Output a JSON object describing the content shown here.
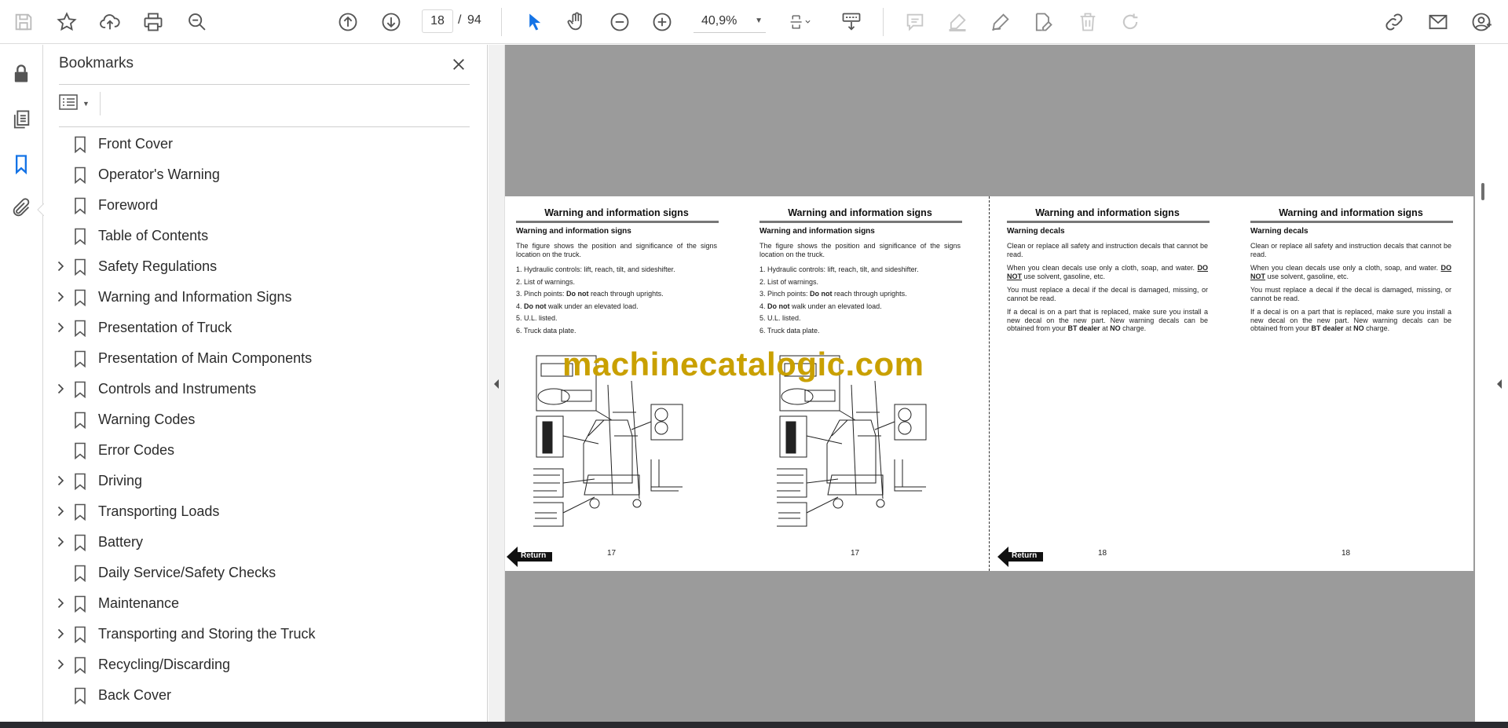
{
  "toolbar": {
    "page_current": "18",
    "page_separator": "/",
    "page_total": "94",
    "zoom": "40,9%",
    "icons": [
      "save-icon",
      "star-icon",
      "upload-icon",
      "print-icon",
      "search-zoom-icon",
      "prev-page-icon",
      "next-page-icon",
      "select-cursor-icon",
      "hand-icon",
      "zoom-out-icon",
      "zoom-in-icon",
      "page-fit-icon",
      "scroll-mode-icon",
      "comment-icon",
      "highlight-icon",
      "sign-icon",
      "edit-icon",
      "delete-icon",
      "redo-icon",
      "share-link-icon",
      "mail-icon",
      "account-icon"
    ]
  },
  "leftrail": {
    "icons": [
      "lock-icon",
      "pages-icon",
      "bookmark-icon",
      "attachment-icon"
    ]
  },
  "panel": {
    "title": "Bookmarks",
    "bookmarks": [
      {
        "label": "Front Cover",
        "expandable": false
      },
      {
        "label": "Operator's Warning",
        "expandable": false
      },
      {
        "label": "Foreword",
        "expandable": false
      },
      {
        "label": "Table of Contents",
        "expandable": false
      },
      {
        "label": "Safety Regulations",
        "expandable": true
      },
      {
        "label": "Warning and Information Signs",
        "expandable": true
      },
      {
        "label": "Presentation of Truck",
        "expandable": true
      },
      {
        "label": "Presentation of Main Components",
        "expandable": false
      },
      {
        "label": "Controls and Instruments",
        "expandable": true
      },
      {
        "label": "Warning Codes",
        "expandable": false
      },
      {
        "label": "Error Codes",
        "expandable": false
      },
      {
        "label": "Driving",
        "expandable": true
      },
      {
        "label": "Transporting Loads",
        "expandable": true
      },
      {
        "label": "Battery",
        "expandable": true
      },
      {
        "label": "Daily Service/Safety Checks",
        "expandable": false
      },
      {
        "label": "Maintenance",
        "expandable": true
      },
      {
        "label": "Transporting and Storing the Truck",
        "expandable": true
      },
      {
        "label": "Recycling/Discarding",
        "expandable": true
      },
      {
        "label": "Back Cover",
        "expandable": false
      }
    ]
  },
  "document": {
    "watermark": "machinecatalogic.com",
    "return_label": "Return",
    "pages": [
      {
        "title": "Warning and information signs",
        "subtitle": "Warning and information signs",
        "intro": "The figure shows the position and significance of the signs location on the truck.",
        "items": [
          "1. Hydraulic controls: lift, reach, tilt, and sideshifter.",
          "2. List of warnings.",
          "3. Pinch points: Do not reach through uprights.",
          "4. Do not walk under an elevated load.",
          "5. U.L. listed.",
          "6. Truck data plate."
        ],
        "page_number": "17"
      },
      {
        "title": "Warning and information signs",
        "subtitle": "Warning and information signs",
        "intro": "The figure shows the position and significance of the signs location on the truck.",
        "items": [
          "1. Hydraulic controls: lift, reach, tilt, and sideshifter.",
          "2. List of warnings.",
          "3. Pinch points: Do not reach through uprights.",
          "4. Do not walk under an elevated load.",
          "5. U.L. listed.",
          "6. Truck data plate."
        ],
        "page_number": "17"
      },
      {
        "title": "Warning and information signs",
        "subtitle": "Warning decals",
        "paragraphs": [
          "Clean or replace all safety and instruction decals that cannot be read.",
          "When you clean decals use only a cloth, soap, and water. DO NOT use solvent, gasoline, etc.",
          "You must replace a decal if the decal is damaged, missing, or cannot be read.",
          "If a decal is on a part that is replaced, make sure you install a new decal on the new part. New warning decals can be obtained from your BT dealer at NO charge."
        ],
        "page_number": "18"
      },
      {
        "title": "Warning and information signs",
        "subtitle": "Warning decals",
        "paragraphs": [
          "Clean or replace all safety and instruction decals that cannot be read.",
          "When you clean decals use only a cloth, soap, and water. DO NOT use solvent, gasoline, etc.",
          "You must replace a decal if the decal is damaged, missing, or cannot be read.",
          "If a decal is on a part that is replaced, make sure you install a new decal on the new part. New warning decals can be obtained from your BT dealer at NO charge."
        ],
        "page_number": "18"
      }
    ]
  }
}
